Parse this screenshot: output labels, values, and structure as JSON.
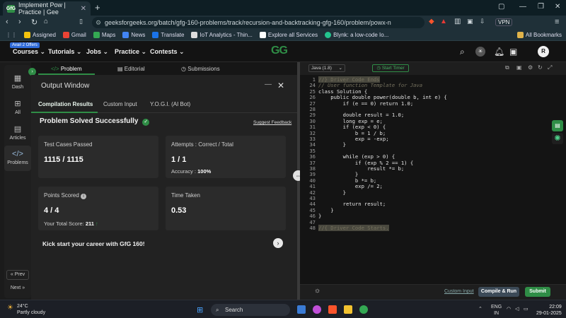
{
  "browser": {
    "tab_title": "Implement Pow | Practice | Gee",
    "tab_favicon": "GfG",
    "url": "geeksforgeeks.org/batch/gfg-160-problems/track/recursion-and-backtracking-gfg-160/problem/powx-n",
    "vpn_label": "VPN",
    "bookmarks": [
      "Assigned",
      "Gmail",
      "Maps",
      "News",
      "Translate",
      "IoT Analytics - Thin...",
      "Explore all Services",
      "Blynk: a low-code Io..."
    ],
    "all_bookmarks": "All Bookmarks"
  },
  "site": {
    "offer_badge": "Avail 2 Offers",
    "nav": [
      "Courses",
      "Tutorials",
      "Jobs",
      "Practice",
      "Contests"
    ],
    "logo": "GG",
    "avatar_letter": "R"
  },
  "sidebar": {
    "items": [
      {
        "label": "Dash",
        "icon": "dashboard-icon"
      },
      {
        "label": "All",
        "icon": "grid-icon"
      },
      {
        "label": "Articles",
        "icon": "articles-icon"
      },
      {
        "label": "Problems",
        "icon": "code-icon"
      }
    ],
    "prev": "Prev",
    "next": "Next"
  },
  "problem_tabs": [
    "Problem",
    "Editorial",
    "Submissions"
  ],
  "output": {
    "title": "Output Window",
    "tabs": [
      "Compilation Results",
      "Custom Input",
      "Y.O.G.I. (AI Bot)"
    ],
    "status": "Problem Solved Successfully",
    "suggest": "Suggest Feedback",
    "test_cases_label": "Test Cases Passed",
    "test_cases_value": "1115 / 1115",
    "attempts_label": "Attempts : Correct / Total",
    "attempts_value": "1 / 1",
    "accuracy_label": "Accuracy :",
    "accuracy_value": "100%",
    "points_label": "Points Scored",
    "points_value": "4 / 4",
    "total_score_label": "Your Total Score:",
    "total_score_value": "211",
    "time_label": "Time Taken",
    "time_value": "0.53",
    "career_text": "Kick start your career with GfG 160!"
  },
  "editor": {
    "language": "Java (1.8)",
    "timer": "Start Timer",
    "lines": [
      {
        "n": "1",
        "t": "//} Driver Code Ends",
        "c": "fold"
      },
      {
        "n": "24",
        "t": "// User function Template for Java",
        "c": "cm"
      },
      {
        "n": "25",
        "t": "class Solution {",
        "c": ""
      },
      {
        "n": "26",
        "t": "    public double power(double b, int e) {",
        "c": ""
      },
      {
        "n": "27",
        "t": "        if (e == 0) return 1.0;",
        "c": ""
      },
      {
        "n": "28",
        "t": "",
        "c": ""
      },
      {
        "n": "29",
        "t": "        double result = 1.0;",
        "c": ""
      },
      {
        "n": "30",
        "t": "        long exp = e;",
        "c": ""
      },
      {
        "n": "31",
        "t": "        if (exp < 0) {",
        "c": ""
      },
      {
        "n": "32",
        "t": "            b = 1 / b;",
        "c": ""
      },
      {
        "n": "33",
        "t": "            exp = -exp;",
        "c": ""
      },
      {
        "n": "34",
        "t": "        }",
        "c": ""
      },
      {
        "n": "35",
        "t": "",
        "c": ""
      },
      {
        "n": "36",
        "t": "        while (exp > 0) {",
        "c": ""
      },
      {
        "n": "37",
        "t": "            if (exp % 2 == 1) {",
        "c": ""
      },
      {
        "n": "38",
        "t": "                result *= b;",
        "c": ""
      },
      {
        "n": "39",
        "t": "            }",
        "c": ""
      },
      {
        "n": "40",
        "t": "            b *= b;",
        "c": ""
      },
      {
        "n": "41",
        "t": "            exp /= 2;",
        "c": ""
      },
      {
        "n": "42",
        "t": "        }",
        "c": ""
      },
      {
        "n": "43",
        "t": "",
        "c": ""
      },
      {
        "n": "44",
        "t": "        return result;",
        "c": ""
      },
      {
        "n": "45",
        "t": "    }",
        "c": ""
      },
      {
        "n": "46",
        "t": "}",
        "c": ""
      },
      {
        "n": "47",
        "t": "",
        "c": ""
      },
      {
        "n": "48",
        "t": "//{ Driver Code Starts.",
        "c": "fold"
      }
    ],
    "custom_input": "Custom Input",
    "compile": "Compile & Run",
    "submit": "Submit"
  },
  "taskbar": {
    "temp": "24°C",
    "weather": "Partly cloudy",
    "search": "Search",
    "lang1": "ENG",
    "lang2": "IN",
    "time": "22:09",
    "date": "29-01-2025"
  },
  "colors": {
    "accent": "#2f8d46",
    "bg": "#1b1b1b"
  }
}
